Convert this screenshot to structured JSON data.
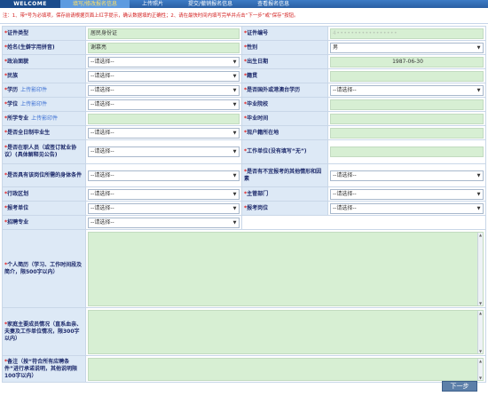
{
  "topbar": {
    "welcome": "WELCOME",
    "tabs": [
      "填写/修改报名信息",
      "上传照片",
      "提交/撤销报名信息",
      "查看报名信息"
    ],
    "active_index": 0
  },
  "notice": "注：1、带*号为必填项，保存前请根据页面上红字提示，确认数据填的正确性；2、请在最快时间内填写完毕并点击“下一步”或“保存”按钮。",
  "form": {
    "id_type": {
      "label": "证件类型",
      "value": "居民身份证"
    },
    "id_number": {
      "label": "证件编号",
      "value": "4•••••••••••••••••"
    },
    "name": {
      "label": "姓名(生僻字用拼音)",
      "value": "谢慕亮"
    },
    "gender": {
      "label": "性别",
      "value": "男"
    },
    "politics": {
      "label": "政治面貌",
      "value": "--请选择--"
    },
    "birth": {
      "label": "出生日期",
      "value": "1987-06-30"
    },
    "ethnicity": {
      "label": "民族",
      "value": "--请选择--"
    },
    "native": {
      "label": "籍贯",
      "value": ""
    },
    "education": {
      "label": "学历",
      "upload": "上传影印件",
      "value": "--请选择--"
    },
    "overseas": {
      "label": "是否国外或港澳台学历",
      "value": "--请选择--"
    },
    "degree": {
      "label": "学位",
      "upload": "上传影印件",
      "value": "--请选择--"
    },
    "school": {
      "label": "毕业院校",
      "value": ""
    },
    "major": {
      "label": "所学专业",
      "upload": "上传影印件",
      "value": ""
    },
    "grad_time": {
      "label": "毕业时间",
      "value": ""
    },
    "fulltime": {
      "label": "是否全日制毕业生",
      "value": "--请选择--"
    },
    "hukou": {
      "label": "现户籍所在地",
      "value": ""
    },
    "employed": {
      "label": "是否在职人员（或签订就业协议）(具体解释见公告)",
      "value": "--请选择--"
    },
    "workplace": {
      "label": "工作单位(没有填写“无”)",
      "value": ""
    },
    "physical": {
      "label": "是否具有该岗位所需的身体条件",
      "value": "--请选择--"
    },
    "bad_record": {
      "label": "是否有不宜报考的其他情形和因素",
      "value": "--请选择--"
    },
    "district": {
      "label": "行政区划",
      "value": "--请选择--"
    },
    "dept": {
      "label": "主管部门",
      "value": "--请选择--"
    },
    "unit": {
      "label": "报考单位",
      "value": "--请选择--"
    },
    "post": {
      "label": "报考岗位",
      "value": "--请选择--"
    },
    "recruit_major": {
      "label": "招聘专业",
      "value": "--请选择--"
    },
    "resume": {
      "label": "个人简历（学习、工作时间段及简介，限500字以内）"
    },
    "family": {
      "label": "家庭主要成员情况（直系血亲、夫妻及工作单位情况，限300字以内）"
    },
    "remark": {
      "label": "备注（按“符合所有应聘条件”进行承诺说明，其他说明限100字以内）"
    }
  },
  "next_button": "下一步"
}
